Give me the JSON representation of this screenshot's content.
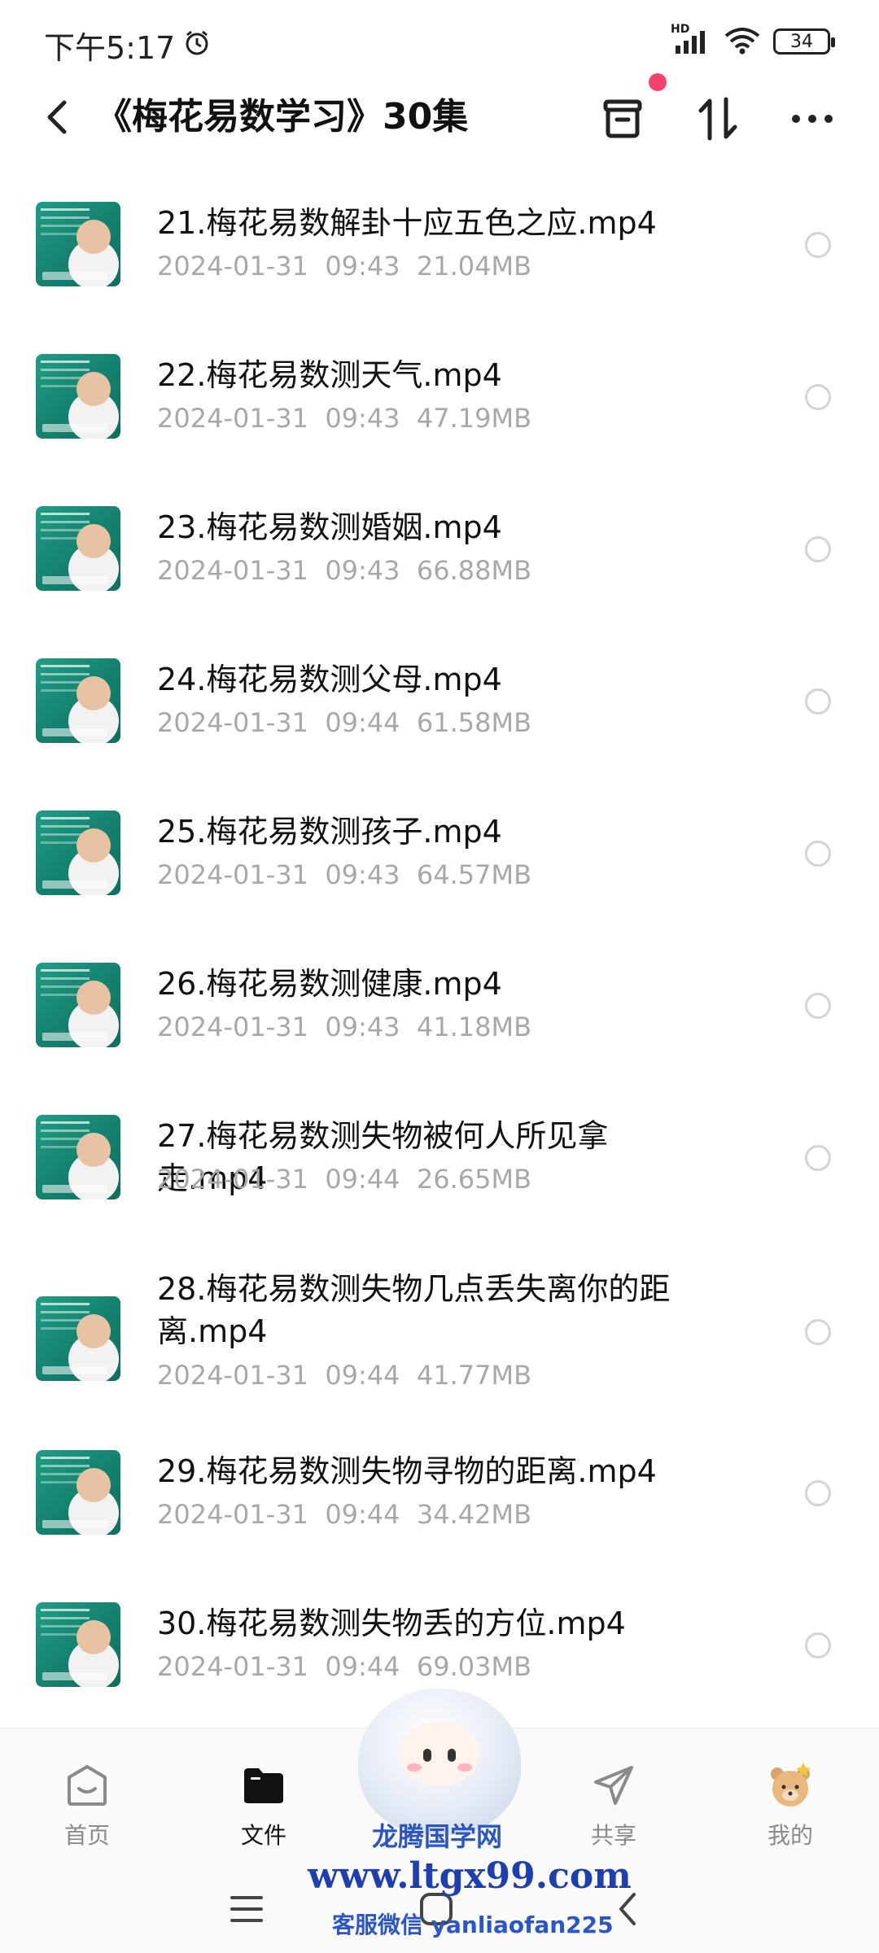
{
  "status_bar": {
    "time": "下午5:17",
    "network": "HD",
    "battery": "34"
  },
  "header": {
    "title": "《梅花易数学习》30集"
  },
  "files": [
    {
      "name": "21.梅花易数解卦十应五色之应.mp4",
      "date": "2024-01-31",
      "time": "09:43",
      "size": "21.04MB"
    },
    {
      "name": "22.梅花易数测天气.mp4",
      "date": "2024-01-31",
      "time": "09:43",
      "size": "47.19MB"
    },
    {
      "name": "23.梅花易数测婚姻.mp4",
      "date": "2024-01-31",
      "time": "09:43",
      "size": "66.88MB"
    },
    {
      "name": "24.梅花易数测父母.mp4",
      "date": "2024-01-31",
      "time": "09:44",
      "size": "61.58MB"
    },
    {
      "name": "25.梅花易数测孩子.mp4",
      "date": "2024-01-31",
      "time": "09:43",
      "size": "64.57MB"
    },
    {
      "name": "26.梅花易数测健康.mp4",
      "date": "2024-01-31",
      "time": "09:43",
      "size": "41.18MB"
    },
    {
      "name": "27.梅花易数测失物被何人所见拿走.mp4",
      "date": "2024-01-31",
      "time": "09:44",
      "size": "26.65MB"
    },
    {
      "name": "28.梅花易数测失物几点丢失离你的距离.mp4",
      "date": "2024-01-31",
      "time": "09:44",
      "size": "41.77MB"
    },
    {
      "name": "29.梅花易数测失物寻物的距离.mp4",
      "date": "2024-01-31",
      "time": "09:44",
      "size": "34.42MB"
    },
    {
      "name": "30.梅花易数测失物丢的方位.mp4",
      "date": "2024-01-31",
      "time": "09:44",
      "size": "69.03MB"
    }
  ],
  "bottom_nav": {
    "home": "首页",
    "files": "文件",
    "share": "共享",
    "mine": "我的"
  },
  "watermark": {
    "site_name": "龙腾国学网",
    "url": "www.ltgx99.com",
    "wechat": "客服微信 yanliaofan225"
  },
  "colors": {
    "accent_dot": "#f44268",
    "thumb_board": "#1f9d86",
    "meta_text": "#a8a8a8"
  }
}
